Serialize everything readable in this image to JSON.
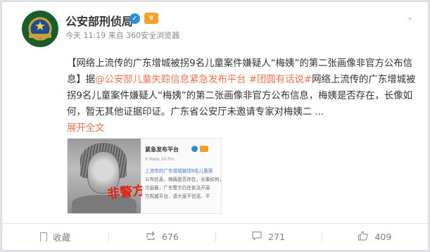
{
  "post": {
    "author": "公安部刑侦局",
    "meta": "今天 11:19 来自 360安全浏览器",
    "text_parts": {
      "prefix": "【",
      "title": "网络上流传的广东增城被拐9名儿童案件嫌疑人“梅姨”的第二张画像非官方公布信息",
      "after_title": "】据",
      "mention": "@公安部儿童失踪信息紧急发布平台",
      "space": " ",
      "hashtag": "#团圆有话说#",
      "body": "网络上流传的广东增城被拐9名儿童案件嫌疑人“梅姨”的第二张画像非官方公布信息，梅姨是否存在，长像如何，暂无其他证据印证。广东省公安厅未邀请专家对梅姨二 ..."
    },
    "expand_label": "展开全文",
    "media": {
      "stamp": "非警方",
      "shot": {
        "title": "紧急发布平台",
        "meta": "9 Mate 20 Pro",
        "lines": [
          "上流传的广东增城被拐9名儿童案",
          "公布信息，梅姨是否存在，长像如何，暂无其",
          "次画像，广东警方仍在依法开展",
          "方权威平台，请大家不信谣、不",
          ""
        ]
      }
    }
  },
  "actions": {
    "favorite_label": "收藏",
    "forward_count": "676",
    "comment_count": "271",
    "like_count": "409"
  },
  "colors": {
    "link": "#eb7350",
    "verify": "#2b8cdb",
    "member": "#f4a328",
    "stamp": "#e2231a"
  }
}
